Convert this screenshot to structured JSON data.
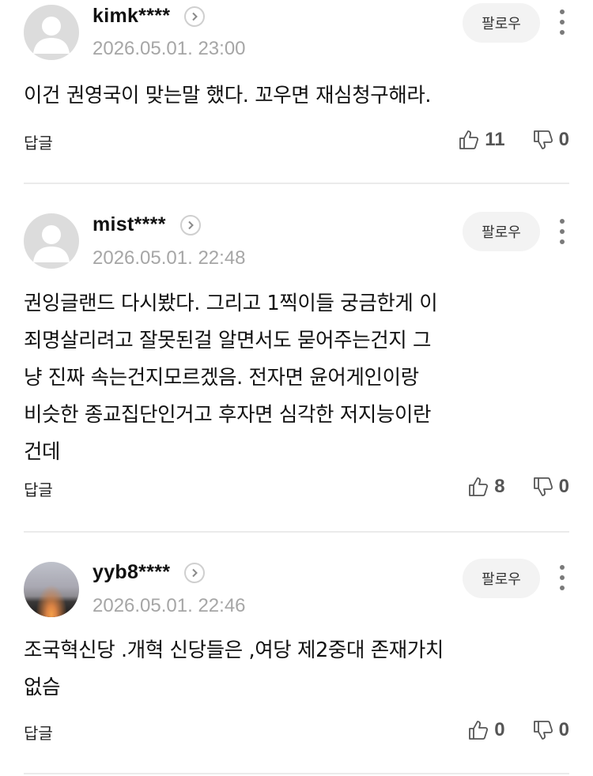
{
  "comments": [
    {
      "username": "kimk****",
      "timestamp": "2026.05.01. 23:00",
      "follow_label": "팔로우",
      "body": "이건 권영국이 맞는말 했다. 꼬우면 재심청구해라.",
      "reply_label": "답글",
      "likes": "11",
      "dislikes": "0",
      "avatar": "default-avatar"
    },
    {
      "username": "mist****",
      "timestamp": "2026.05.01. 22:48",
      "follow_label": "팔로우",
      "body_lines": [
        "권잉글랜드 다시봤다. 그리고 1찍이들 궁금한게 이",
        "죄명살리려고 잘못된걸 알면서도 묻어주는건지 그",
        "냥 진짜 속는건지모르겠음. 전자면 윤어게인이랑",
        "비슷한 종교집단인거고 후자면 심각한 저지능이란",
        "건데"
      ],
      "reply_label": "답글",
      "likes": "8",
      "dislikes": "0",
      "avatar": "default-avatar"
    },
    {
      "username": "yyb8****",
      "timestamp": "2026.05.01. 22:46",
      "follow_label": "팔로우",
      "body_lines": [
        "조국혁신당 .개혁 신당들은 ,여당 제2중대 존재가치",
        "없슴"
      ],
      "reply_label": "답글",
      "likes": "0",
      "dislikes": "0",
      "avatar": "sunset-photo"
    }
  ]
}
